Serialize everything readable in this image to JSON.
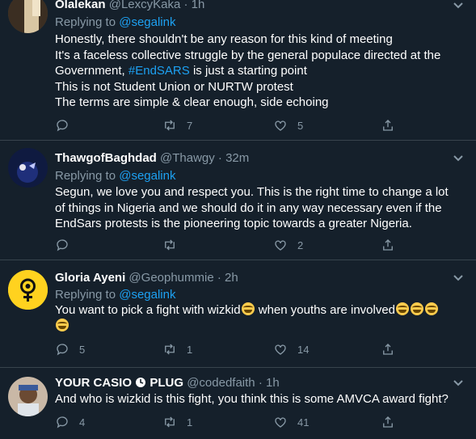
{
  "tweets": [
    {
      "name": "Olalekan",
      "handle": "@LexcyKaka",
      "dot": "·",
      "time": "1h",
      "replying_prefix": "Replying to",
      "mention": "@segalink",
      "lines": [
        "Honestly, there shouldn't be any reason for this kind of meeting",
        "It's a faceless collective struggle by the general populace directed at the",
        "is just a starting point",
        "This is not Student Union or NURTW protest",
        "The terms are simple & clear enough, side echoing"
      ],
      "line3_prefix": "Government,",
      "hashtag": "#EndSARS",
      "retweets": "7",
      "likes": "5"
    },
    {
      "name": "ThawgofBaghdad",
      "handle": "@Thawgy",
      "dot": "·",
      "time": "32m",
      "replying_prefix": "Replying to",
      "mention": "@segalink",
      "lines": [
        "Segun, we love you and respect you. This is the right time to change a lot",
        "of things in Nigeria and we should do it in any way necessary even if the",
        "EndSars protests is the pioneering topic towards a greater Nigeria."
      ],
      "retweets": "",
      "likes": "2"
    },
    {
      "name": "Gloria Ayeni",
      "handle": "@Geophummie",
      "dot": "·",
      "time": "2h",
      "replying_prefix": "Replying to",
      "mention": "@segalink",
      "line1_a": "You want to pick a fight with wizkid",
      "line1_b": "when youths are involved",
      "replies": "5",
      "retweets": "1",
      "likes": "14"
    },
    {
      "name": "YOUR CASIO",
      "name_b": "PLUG",
      "handle": "@codedfaith",
      "dot": "·",
      "time": "1h",
      "lines": [
        "And who is wizkid is this fight, you think this is some AMVCA award fight?"
      ],
      "replies": "4",
      "retweets": "1",
      "likes": "41"
    }
  ],
  "icons": [
    "reply-icon",
    "retweet-icon",
    "like-icon",
    "share-icon",
    "chevron-down-icon",
    "clock-icon",
    "rofl-emoji"
  ],
  "colors": {
    "background": "#15202b",
    "accent": "#1da1f2",
    "muted": "#8899a6",
    "divider": "#38444d"
  }
}
